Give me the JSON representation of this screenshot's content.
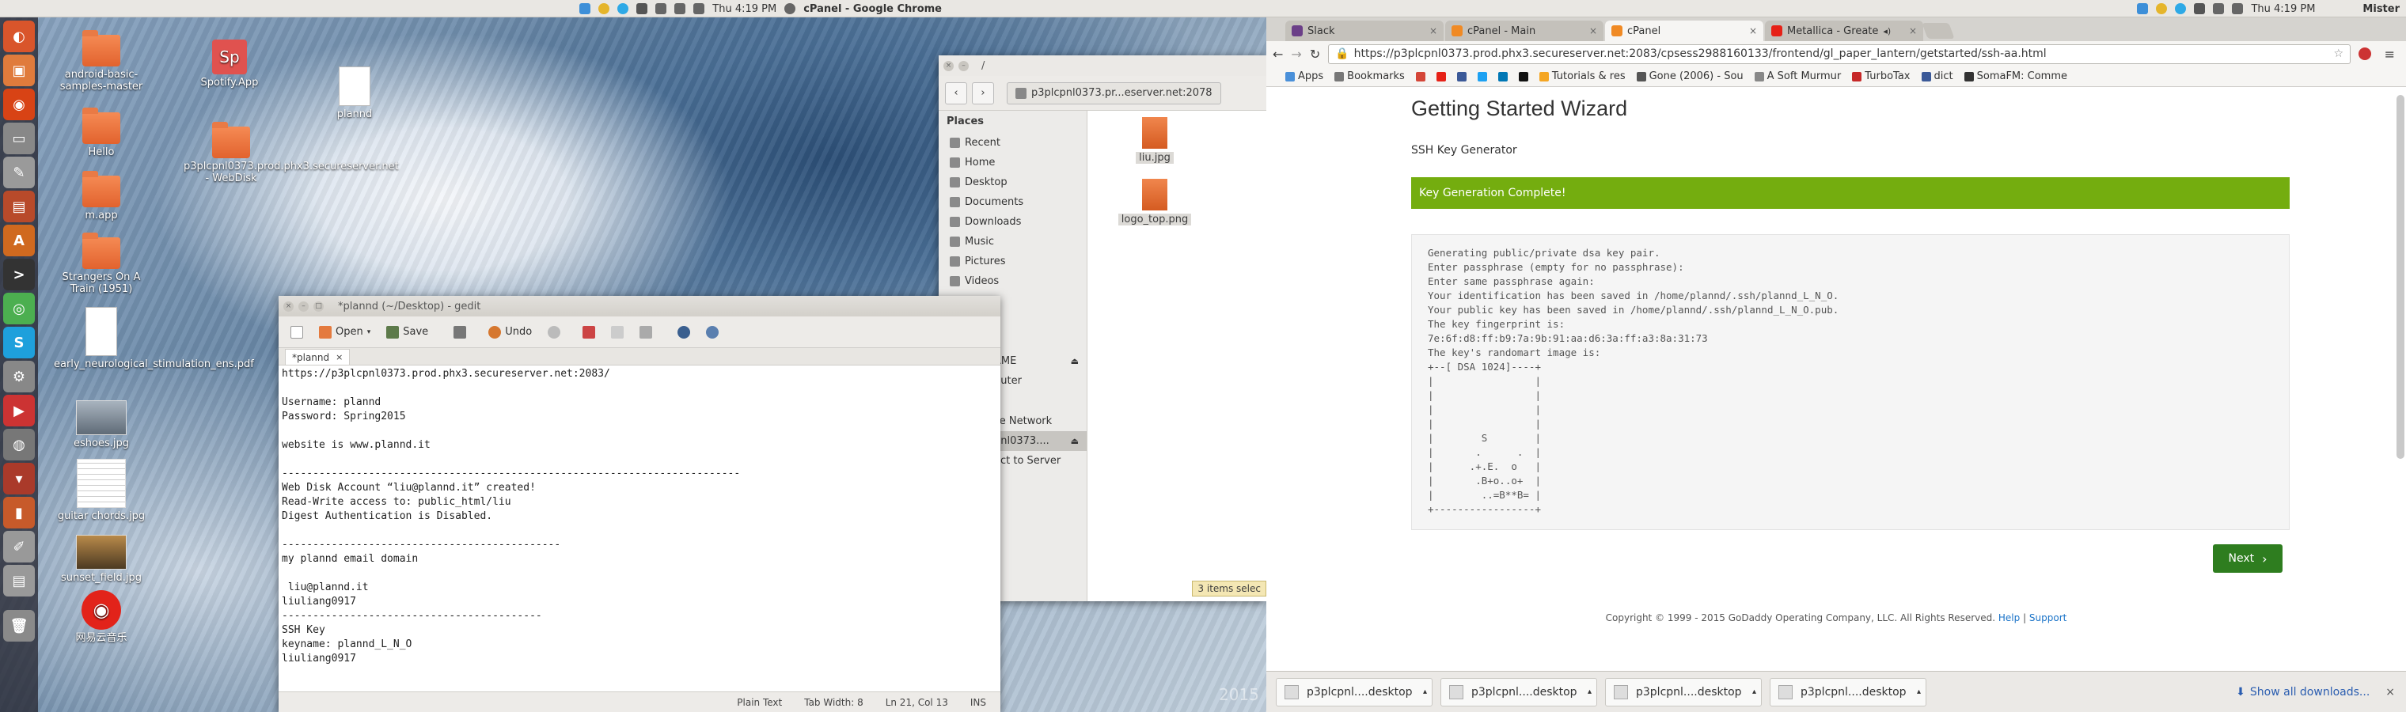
{
  "left_panel": {
    "panel_title": "cPanel - Google Chrome",
    "clock": "Thu 4:19 PM",
    "desktop_icons": [
      {
        "label": "android-basic-samples-master",
        "kind": "folder"
      },
      {
        "label": "Spotify.App",
        "kind": "app"
      },
      {
        "label": "plannd",
        "kind": "file"
      },
      {
        "label": "Hello",
        "kind": "folder"
      },
      {
        "label": "p3plcpnl0373.prod.phx3.secureserver.net - WebDisk",
        "kind": "folder"
      },
      {
        "label": "m.app",
        "kind": "folder"
      },
      {
        "label": "Strangers On A Train (1951)",
        "kind": "folder"
      },
      {
        "label": "early_neurological_stimulation_ens.pdf",
        "kind": "file"
      },
      {
        "label": "eshoes.jpg",
        "kind": "image"
      },
      {
        "label": "guitar chords.jpg",
        "kind": "image"
      },
      {
        "label": "sunset_field.jpg",
        "kind": "image"
      },
      {
        "label": "网易云音乐",
        "kind": "app"
      }
    ],
    "gedit": {
      "title": "*plannd (~/Desktop) - gedit",
      "toolbar": {
        "open": "Open",
        "save": "Save",
        "undo": "Undo"
      },
      "tab": "*plannd",
      "content": "https://p3plcpnl0373.prod.phx3.secureserver.net:2083/\n\nUsername: plannd\nPassword: Spring2015\n\nwebsite is www.plannd.it\n\n--------------------------------------------------------------------------\nWeb Disk Account “liu@plannd.it” created!\nRead-Write access to: public_html/liu\nDigest Authentication is Disabled.\n\n---------------------------------------------\nmy plannd email domain\n\n liu@plannd.it\nliuliang0917\n------------------------------------------\nSSH Key\nkeyname: plannd_L_N_O\nliuliang0917",
      "status": {
        "lang": "Plain Text",
        "tab_width": "Tab Width: 8",
        "position": "Ln 21, Col 13",
        "mode": "INS"
      }
    },
    "files": {
      "path": "/",
      "location": "p3plcpnl0373.pr...eserver.net:2078",
      "places_header": "Places",
      "places": [
        "Recent",
        "Home",
        "Desktop",
        "Documents",
        "Downloads",
        "Music",
        "Pictures",
        "Videos"
      ],
      "extra_places": [
        "AME",
        "puter",
        "se Network",
        "pnl0373....",
        "ect to Server"
      ],
      "files": [
        {
          "name": "liu.jpg"
        },
        {
          "name": "logo_top.png"
        }
      ],
      "status": "3 items selec"
    },
    "watermark_year": "2015"
  },
  "right_panel": {
    "panel_title": "Mister",
    "clock": "Thu 4:19 PM",
    "tabs": [
      {
        "label": "Slack",
        "color": "#6b3f88"
      },
      {
        "label": "cPanel - Main",
        "color": "#f08a24"
      },
      {
        "label": "cPanel",
        "color": "#f08a24",
        "active": true
      },
      {
        "label": "Metallica - Greate",
        "color": "#e62117"
      }
    ],
    "url": "https://p3plcpnl0373.prod.phx3.secureserver.net:2083/cpsess2988160133/frontend/gl_paper_lantern/getstarted/ssh-aa.html",
    "bookmarks": [
      {
        "label": "Apps",
        "color": "#4a90d9"
      },
      {
        "label": "Bookmarks",
        "color": "#777777"
      },
      {
        "label": "",
        "color": "#d44638"
      },
      {
        "label": "",
        "color": "#e62117"
      },
      {
        "label": "",
        "color": "#3b5998"
      },
      {
        "label": "",
        "color": "#1da1f2"
      },
      {
        "label": "",
        "color": "#0077b5"
      },
      {
        "label": "",
        "color": "#111111"
      },
      {
        "label": "Tutorials & res",
        "color": "#f5a623"
      },
      {
        "label": "Gone (2006) - Sou",
        "color": "#555555"
      },
      {
        "label": "A Soft Murmur",
        "color": "#888888"
      },
      {
        "label": "TurboTax",
        "color": "#c62828"
      },
      {
        "label": "dict",
        "color": "#3b5998"
      },
      {
        "label": "SomaFM: Comme",
        "color": "#333333"
      }
    ],
    "wizard": {
      "heading": "Getting Started Wizard",
      "subheading": "SSH Key Generator",
      "banner": "Key Generation Complete!",
      "output": "Generating public/private dsa key pair.\nEnter passphrase (empty for no passphrase):\nEnter same passphrase again:\nYour identification has been saved in /home/plannd/.ssh/plannd_L_N_O.\nYour public key has been saved in /home/plannd/.ssh/plannd_L_N_O.pub.\nThe key fingerprint is:\n7e:6f:d8:ff:b9:7a:9b:91:aa:d6:3a:ff:a3:8a:31:73\nThe key's randomart image is:\n+--[ DSA 1024]----+\n|                 |\n|                 |\n|                 |\n|                 |\n|        S        |\n|       .      .  |\n|      .+.E.  o   |\n|       .B+o..o+  |\n|        ..=B**B= |\n+-----------------+",
      "next_button": "Next",
      "footer": "Copyright © 1999 - 2015 GoDaddy Operating Company, LLC. All Rights Reserved.",
      "footer_links": [
        "Help",
        "Support"
      ]
    },
    "downloads": [
      "p3plcpnl....desktop",
      "p3plcpnl....desktop",
      "p3plcpnl....desktop",
      "p3plcpnl....desktop"
    ],
    "show_all": "Show all downloads..."
  }
}
